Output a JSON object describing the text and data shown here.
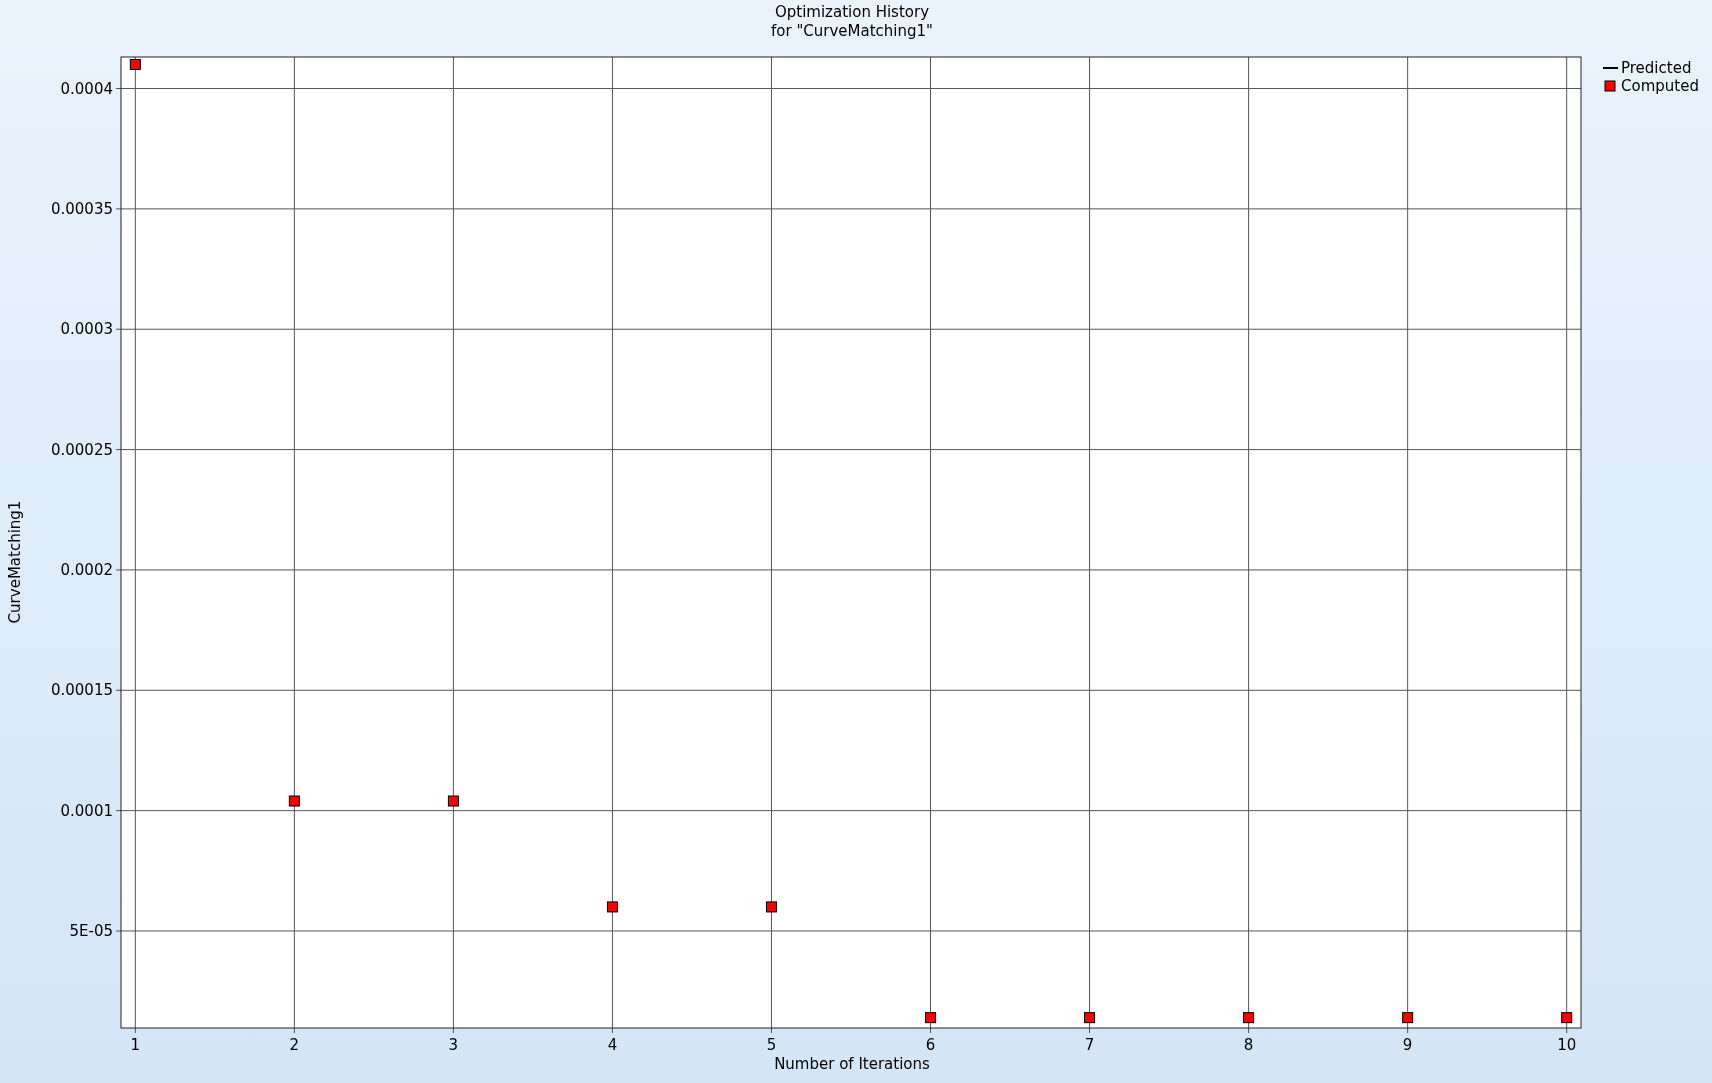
{
  "chart": {
    "chart_data": {
      "type": "scatter",
      "title": "Optimization History\nfor \"CurveMatching1\"",
      "xlabel": "Number of Iterations",
      "ylabel": "CurveMatching1",
      "x": [
        1,
        2,
        3,
        4,
        5,
        6,
        7,
        8,
        9,
        10
      ],
      "series": [
        {
          "name": "Predicted",
          "color": "#000000",
          "values": [
            null,
            null,
            null,
            null,
            null,
            null,
            null,
            null,
            null,
            null
          ]
        },
        {
          "name": "Computed",
          "color": "#ff0000",
          "values": [
            0.00041,
            0.000104,
            0.000104,
            6e-05,
            6e-05,
            1.4e-05,
            1.4e-05,
            1.4e-05,
            1.4e-05,
            1.4e-05
          ]
        }
      ],
      "grid": true,
      "xlim": [
        0.91,
        10.09
      ],
      "ylim": [
        9.7e-06,
        0.0004131
      ],
      "xticks": [
        1,
        2,
        3,
        4,
        5,
        6,
        7,
        8,
        9,
        10
      ],
      "yticks": [
        {
          "value": 5e-05,
          "label": "5E-05"
        },
        {
          "value": 0.0001,
          "label": "0.0001"
        },
        {
          "value": 0.00015,
          "label": "0.00015"
        },
        {
          "value": 0.0002,
          "label": "0.0002"
        },
        {
          "value": 0.00025,
          "label": "0.00025"
        },
        {
          "value": 0.0003,
          "label": "0.0003"
        },
        {
          "value": 0.00035,
          "label": "0.00035"
        },
        {
          "value": 0.0004,
          "label": "0.0004"
        }
      ]
    }
  }
}
